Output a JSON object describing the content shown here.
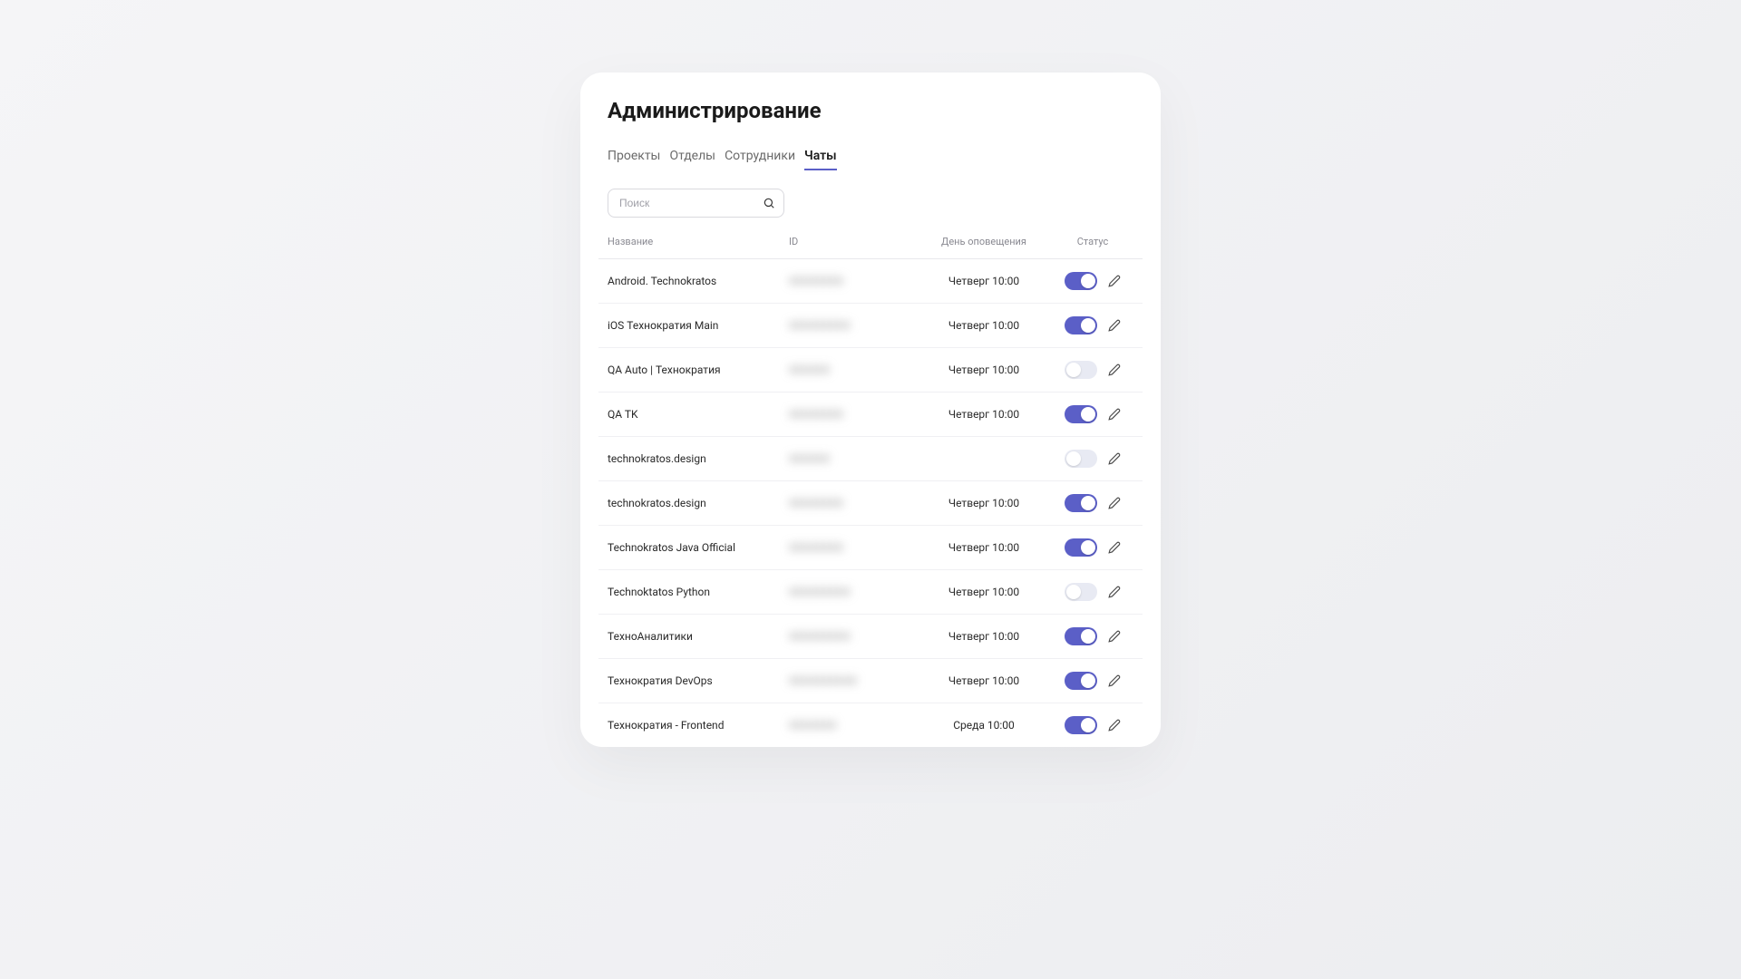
{
  "title": "Администрирование",
  "tabs": [
    {
      "label": "Проекты",
      "active": false
    },
    {
      "label": "Отделы",
      "active": false
    },
    {
      "label": "Сотрудники",
      "active": false
    },
    {
      "label": "Чаты",
      "active": true
    }
  ],
  "search": {
    "placeholder": "Поиск"
  },
  "columns": {
    "name": "Название",
    "id": "ID",
    "day": "День оповещения",
    "status": "Статус"
  },
  "rows": [
    {
      "name": "Android. Technokratos",
      "id": "XXXXXXXX",
      "day": "Четверг 10:00",
      "status": true
    },
    {
      "name": "iOS Технократия Main ",
      "id": "XXXXXXXXX",
      "day": "Четверг 10:00",
      "status": true
    },
    {
      "name": "QA Auto | Технократия",
      "id": "XXXXXX",
      "day": "Четверг 10:00",
      "status": false
    },
    {
      "name": "QA TK",
      "id": "XXXXXXXX",
      "day": "Четверг 10:00",
      "status": true
    },
    {
      "name": "technokratos.design",
      "id": "XXXXXX",
      "day": "",
      "status": false
    },
    {
      "name": "technokratos.design",
      "id": "XXXXXXXX",
      "day": "Четверг 10:00",
      "status": true
    },
    {
      "name": "Technokratos Java Official",
      "id": "XXXXXXXX",
      "day": "Четверг 10:00",
      "status": true
    },
    {
      "name": "Technoktatos Python",
      "id": "XXXXXXXXX",
      "day": "Четверг 10:00",
      "status": false
    },
    {
      "name": "ТехноАналитики",
      "id": "XXXXXXXXX",
      "day": "Четверг 10:00",
      "status": true
    },
    {
      "name": "Технократия DevOps",
      "id": "XXXXXXXXXX",
      "day": "Четверг 10:00",
      "status": true
    },
    {
      "name": "Технократия - Frontend",
      "id": "XXXXXXX",
      "day": "Среда 10:00",
      "status": true
    }
  ]
}
